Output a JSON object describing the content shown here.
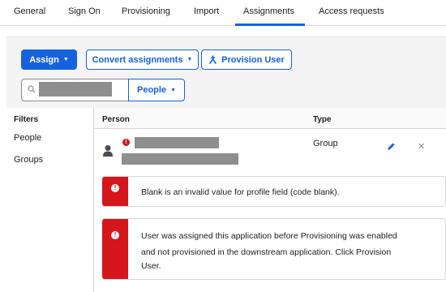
{
  "tabs": [
    {
      "label": "General"
    },
    {
      "label": "Sign On"
    },
    {
      "label": "Provisioning"
    },
    {
      "label": "Import"
    },
    {
      "label": "Assignments"
    },
    {
      "label": "Access requests"
    }
  ],
  "active_tab": "Assignments",
  "toolbar": {
    "assign_label": "Assign",
    "convert_label": "Convert assignments",
    "provision_label": "Provision User"
  },
  "search": {
    "value": "",
    "type_select": "People"
  },
  "filters": {
    "title": "Filters",
    "items": [
      {
        "label": "People"
      },
      {
        "label": "Groups"
      }
    ]
  },
  "table": {
    "columns": {
      "person": "Person",
      "type": "Type"
    },
    "rows": [
      {
        "person_name": "",
        "person_email": "",
        "type": "Group"
      }
    ]
  },
  "errors": [
    {
      "message": "Blank is an invalid value for profile field (code blank)."
    },
    {
      "line1": "User was assigned this application before Provisioning was enabled",
      "line2": "and not provisioned in the downstream application. Click Provision",
      "line3": "User."
    }
  ],
  "colors": {
    "accent": "#1662dd",
    "error": "#d4161d"
  }
}
